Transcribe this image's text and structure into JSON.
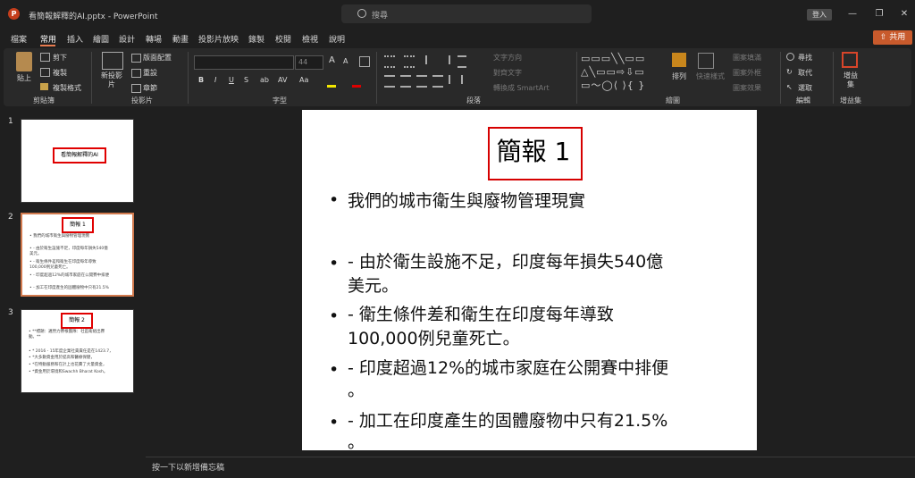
{
  "window": {
    "title": "看簡報解釋的AI.pptx  -  PowerPoint",
    "search_placeholder": "搜尋",
    "login": "登入",
    "minimize": "—",
    "restore": "❐",
    "close": "✕"
  },
  "menu": {
    "tabs": [
      "檔案",
      "常用",
      "插入",
      "繪圖",
      "設計",
      "轉場",
      "動畫",
      "投影片放映",
      "錄製",
      "校閱",
      "檢視",
      "說明"
    ],
    "active": "常用",
    "share": "共用"
  },
  "ribbon": {
    "clipboard": {
      "paste": "貼上",
      "cut": "剪下",
      "copy": "複製",
      "format_painter": "複製格式",
      "group": "剪貼簿"
    },
    "slides": {
      "new_slide": "新投影片",
      "layout": "版面配置",
      "reset": "重設",
      "section": "章節",
      "group": "投影片"
    },
    "font": {
      "size": "44",
      "group": "字型",
      "bold": "B",
      "italic": "I",
      "underline": "U",
      "strike": "S",
      "shadow": "ab",
      "spacing": "AV",
      "case": "Aa",
      "grow": "A",
      "shrink": "A"
    },
    "paragraph": {
      "direction": "文字方向",
      "align": "對齊文字",
      "smartart": "轉換成 SmartArt",
      "group": "段落"
    },
    "drawing": {
      "arrange": "排列",
      "quick_styles": "快速樣式",
      "fill": "圖案填滿",
      "outline": "圖案外框",
      "effects": "圖案效果",
      "group": "繪圖"
    },
    "editing": {
      "find": "尋找",
      "replace": "取代",
      "select": "選取",
      "group": "編輯"
    },
    "addins": {
      "label": "增益集",
      "group": "增益集"
    }
  },
  "thumbnails": [
    {
      "num": "1",
      "title": "看簡報解釋的AI",
      "lines": []
    },
    {
      "num": "2",
      "title": "簡報 1",
      "lines": [
        "• 我們的城市衛生與廢物管理現實",
        "• - 由於衛生設施不足，印度每年損失540億",
        "  美元。",
        "• - 衛生條件差和衛生在印度每年導致",
        "  100,000例兒童死亡。",
        "• - 印度超過12%的城市家庭在公開賽中排便",
        "• - 加工在印度產生的固體廢物中只有21.5%"
      ]
    },
    {
      "num": "3",
      "title": "簡報 2",
      "lines": [
        "• **標題：邁勞力賽根團隊：社區衛組出賽",
        "  動。**",
        "• * 2016 - 15年度企業社責責任是在1423.7，",
        "• *大多數資金用於提高和醫療保健，",
        "• *在特動服務和在計上也花費了大量資金，",
        "• *資金用於環境和Swachh Bharat Kosh。"
      ]
    }
  ],
  "slide": {
    "title": "簡報 1",
    "bullets": [
      "我們的城市衛生與廢物管理現實",
      "- 由於衛生設施不足，印度每年損失540億",
      "美元。",
      "- 衛生條件差和衛生在印度每年導致",
      "100,000例兒童死亡。",
      "- 印度超過12%的城市家庭在公開賽中排便",
      "。",
      "- 加工在印度產生的固體廢物中只有21.5%",
      "。"
    ]
  },
  "notes": {
    "placeholder": "按一下以新增備忘稿"
  },
  "colors": {
    "accent": "#e87b4f",
    "share": "#c85a2c",
    "title_box": "#d60000"
  }
}
